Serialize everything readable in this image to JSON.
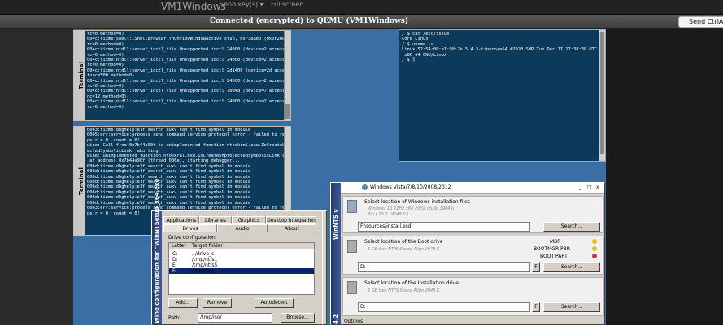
{
  "navbar": {
    "brand": "VM1Windows",
    "send_keys": "Send key(s)",
    "send_keys_caret": "▾",
    "fullscreen": "Fullscreen"
  },
  "status": {
    "text": "Connected (encrypted) to QEMU (VM1Windows)",
    "cad_button": "Send CtrlAl"
  },
  "term1": {
    "title": "Terminal",
    "lines": [
      "rc=0 method=0)",
      "004c:fixme:shell:IShellBrowser_fnOnViewWindowActive stub, 0xF38ae0 (0x0F2b0)",
      "rc=0 method=0)",
      "004c:fixme:ntdll:server_ioctl_file Unsupported ioctl 24000 (device=2 access=1 fu",
      "rc=0 method=0)",
      "004c:fixme:ntdll:server_ioctl_file Unsupported ioctl 24000 (device=2 access=1 fu",
      "rc=0 method=0)",
      "004c:fixme:ntdll:server_ioctl_file Unsupported ioctl 2d1400 (device=2d access=0",
      "func=500 method=0)",
      "004c:fixme:ntdll:server_ioctl_file Unsupported ioctl 24000 (device=2 access=1 fu",
      "rc=0 method=0)",
      "004c:fixme:ntdll:server_ioctl_file Unsupported ioctl 70048 (device=7 access=0 fu",
      "nc=12 method=0)",
      "004c:fixme:ntdll:server_ioctl_file Unsupported ioctl 24000 (device=2 access=1 fu",
      "rc=0 method=0)"
    ]
  },
  "term2": {
    "title": "Terminal",
    "lines": [
      "0063:fixme:dbghelp:elf_search_auxv can't find symbol in module",
      "0065:err:service:process_send_command service protocol error - failed to read pi",
      "pe r = 0  count = 0!",
      "wine: Call from 0x7b44a90f to unimplemented function ntoskrnl.exe.IoCreateUnprot",
      "ectedSymbolicLink, aborting",
      "wine: Unimplemented function ntoskrnl.exe.IoCreateUnprotectedSymbolicLink called",
      " at address 0x7b44a90f (thread 006a), starting debugger...",
      "006d:fixme:dbghelp:elf_search_auxv can't find symbol in module",
      "006d:fixme:dbghelp:elf_search_auxv can't find symbol in module",
      "006d:fixme:dbghelp:elf_search_auxv can't find symbol in module",
      "006d:fixme:dbghelp:elf_search_auxv can't find symbol in module",
      "006d:fixme:dbghelp:elf_search_auxv can't find symbol in module",
      "006d:fixme:dbghelp:elf_search_auxv can't find symbol in module",
      "006d:fixme:dbghelp:elf_search_auxv can't find symbol in module",
      "006d:fixme:dbghelp:elf_search_auxv can't find symbol in module",
      "0063:err:service:process_send_command service protocol error - failed to read pi",
      "pe r = 0  count = 0!"
    ]
  },
  "term3": {
    "lines": [
      "/ $ cat /etc/issue",
      "Core Linux",
      "/ $ uname -a",
      "Linux 52:54:00:e1:98:2b 5.4.3-tinycore64 #2020 SMP Tue Dec 17 17:38:30 UTC 2019",
      " x86_64 GNU/Linux",
      "/ $ ▯"
    ]
  },
  "wine_cfg": {
    "title": "Wine configuration for \"WinNTSetup_x64.exe\"",
    "tabs_row1": [
      "Applications",
      "Libraries",
      "Graphics",
      "Desktop Integration"
    ],
    "tabs_row2": [
      "Drives",
      "Audio",
      "About"
    ],
    "group_label": "Drive configuration",
    "col_letter": "Letter",
    "col_target": "Target folder",
    "drives": [
      {
        "letter": "C:",
        "target": "../drive_c"
      },
      {
        "letter": "D:",
        "target": "/tmp/ntfs1"
      },
      {
        "letter": "E:",
        "target": "/tmp/ntfs5"
      },
      {
        "letter": "F:",
        "target": "/tmp/iso/"
      }
    ],
    "add_button": "Add...",
    "remove_button": "Remove",
    "autodetect_button": "Autodetect",
    "path_label": "Path:",
    "path_value": "/tmp/iso/",
    "browse_button": "Browse..."
  },
  "winntsetup": {
    "title": "WinNTSetup v4.2",
    "title_partial": "WinNTS v",
    "version": "4.2",
    "dialog_header": "Windows Vista/7/8/10/2008/2012",
    "minimize": "_",
    "maximize": "□",
    "close": "x",
    "sec1_label": "Select location of Windows installation files",
    "sec1_sub1": "Windows 10 22H2  x64 20H2 (Build 19045)",
    "sec1_sub2": "Pro  ( 10.0.19045.0 )",
    "sec1_value": "F:\\sources\\install.esd",
    "sec1_button": "Search...",
    "sec2_label": "Select location of the Boot drive",
    "sec2_sub": "5 GB free NTFS Space Align 2048 K",
    "sec2_value": "D:",
    "sec2_f": "F",
    "sec2_button": "Search...",
    "mbr": "MBR",
    "bootmgr_pbr": "BOOTMGR PBR",
    "boot_part": "BOOT PART",
    "sec3_label": "Select location of the Installation drive",
    "sec3_sub": "5 GB free NTFS Space Align 2048 K",
    "sec3_value": "D:",
    "sec3_f": "F",
    "sec3_button": "Search...",
    "options": "Options",
    "status_colors": {
      "mbr": "#e0c020",
      "bootmgr": "#e0c020",
      "bootpart": "#d03030"
    }
  }
}
